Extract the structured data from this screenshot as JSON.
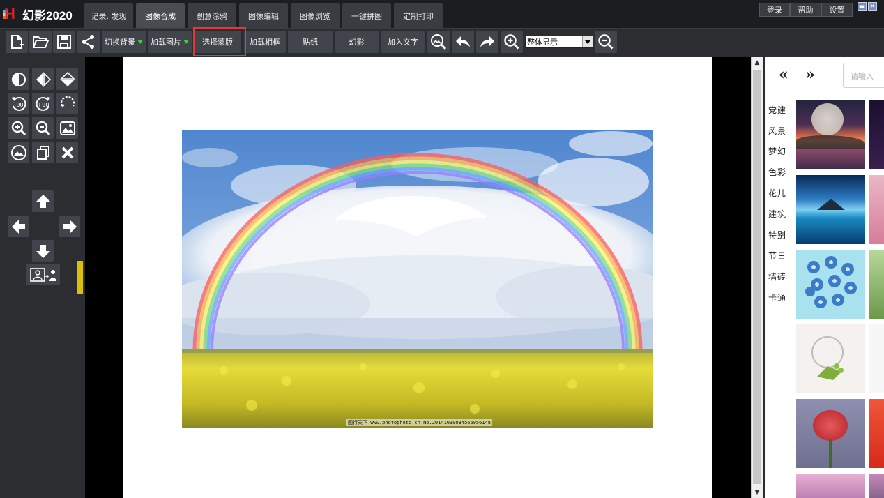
{
  "app": {
    "name": "幻影2020"
  },
  "tabs": [
    {
      "label": "记录. 发现",
      "active": false
    },
    {
      "label": "图像合成",
      "active": true
    },
    {
      "label": "创意涂鸦",
      "active": false
    },
    {
      "label": "图像编辑",
      "active": false
    },
    {
      "label": "图像浏览",
      "active": false
    },
    {
      "label": "一键拼图",
      "active": false
    },
    {
      "label": "定制打印",
      "active": false
    }
  ],
  "top_buttons": {
    "login": "登录",
    "help": "帮助",
    "settings": "设置"
  },
  "window_controls": {
    "minimize": "▬",
    "close": "✕"
  },
  "toolbar": {
    "switch_background": "切换背景",
    "load_picture": "加载图片",
    "select_mask": "选择蒙版",
    "load_frame": "加载相框",
    "sticker": "贴纸",
    "phantom": "幻影",
    "add_text": "加入文字",
    "zoom_mode": "整体显示"
  },
  "canvas": {
    "watermark": "图行天下 www.photophoto.cn No.20141030034566956148"
  },
  "right_panel": {
    "prev": "«",
    "next": "»",
    "search_placeholder": "请输入",
    "categories": [
      "党建",
      "风景",
      "梦幻",
      "色彩",
      "花儿",
      "建筑",
      "特别",
      "节日",
      "墙砖",
      "卡通"
    ]
  },
  "colors": {
    "accent_green": "#39d33f",
    "highlight_red": "#e53935",
    "panel_dark": "#2b2d31",
    "button_gray": "#41444a"
  }
}
